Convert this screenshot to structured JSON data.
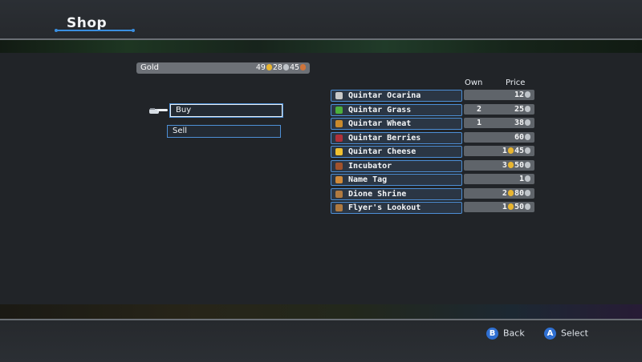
{
  "screen": {
    "title": "Shop"
  },
  "gold": {
    "label": "Gold",
    "g": "49",
    "s": "28",
    "c": "45"
  },
  "menu": {
    "items": [
      {
        "label": "Buy",
        "selected": true
      },
      {
        "label": "Sell",
        "selected": false
      }
    ]
  },
  "table": {
    "headers": {
      "own": "Own",
      "price": "Price"
    },
    "items": [
      {
        "name": "Quintar Ocarina",
        "own": "",
        "price_gold": "",
        "price_silver": "12",
        "icon": "ocarina-icon",
        "icon_color": "#c8c8c8"
      },
      {
        "name": "Quintar Grass",
        "own": "2",
        "price_gold": "",
        "price_silver": "25",
        "icon": "grass-icon",
        "icon_color": "#4caf3c"
      },
      {
        "name": "Quintar Wheat",
        "own": "1",
        "price_gold": "",
        "price_silver": "38",
        "icon": "wheat-icon",
        "icon_color": "#c98a2c"
      },
      {
        "name": "Quintar Berries",
        "own": "",
        "price_gold": "",
        "price_silver": "60",
        "icon": "berries-icon",
        "icon_color": "#b0303a"
      },
      {
        "name": "Quintar Cheese",
        "own": "",
        "price_gold": "1",
        "price_silver": "45",
        "icon": "cheese-icon",
        "icon_color": "#f0c030"
      },
      {
        "name": "Incubator",
        "own": "",
        "price_gold": "3",
        "price_silver": "50",
        "icon": "incubator-icon",
        "icon_color": "#a0522d"
      },
      {
        "name": "Name Tag",
        "own": "",
        "price_gold": "",
        "price_silver": "1",
        "icon": "tag-icon",
        "icon_color": "#d08a3a"
      },
      {
        "name": "Dione Shrine",
        "own": "",
        "price_gold": "2",
        "price_silver": "80",
        "icon": "shrine-icon",
        "icon_color": "#b07a40"
      },
      {
        "name": "Flyer's Lookout",
        "own": "",
        "price_gold": "1",
        "price_silver": "50",
        "icon": "lookout-icon",
        "icon_color": "#b07a40"
      }
    ]
  },
  "footer": {
    "back_key": "B",
    "back_label": "Back",
    "select_key": "A",
    "select_label": "Select"
  }
}
